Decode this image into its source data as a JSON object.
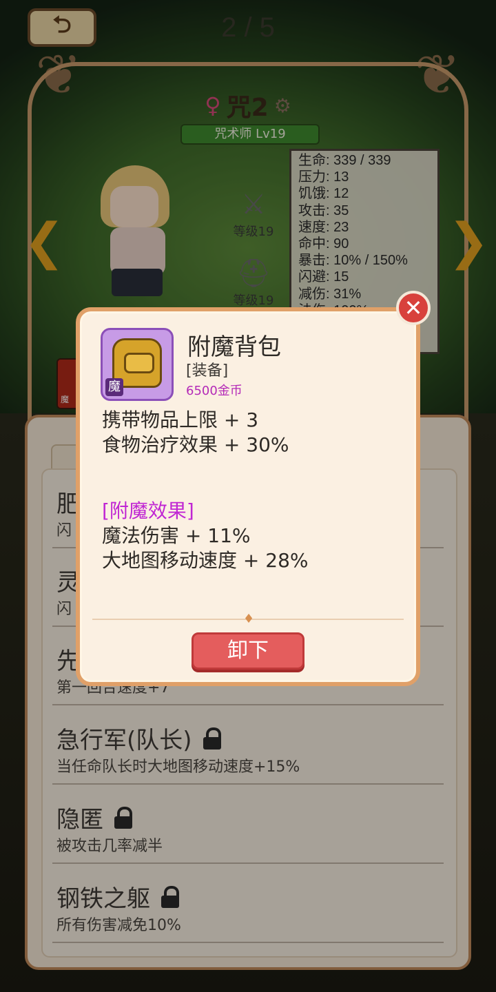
{
  "header": {
    "back_label": "⮌",
    "page_counter": "2 / 5"
  },
  "character": {
    "name": "咒2",
    "gender_symbol": "♀",
    "class_level": "咒术师 Lv19"
  },
  "equipment_slots": [
    {
      "icon": "sword-icon",
      "glyph": "⚔",
      "level": "等级19"
    },
    {
      "icon": "helmet-icon",
      "glyph": "⛑",
      "level": "等级19"
    }
  ],
  "stats": [
    "生命: 339 / 339",
    "压力: 13",
    "饥饿: 12",
    "攻击: 35",
    "速度: 23",
    "命中: 90",
    "暴击: 10% / 150%",
    "闪避: 15",
    "减伤: 31%",
    "法伤: 100%"
  ],
  "skill_badge": "魔",
  "traits": [
    {
      "name": "肥",
      "desc": "闪",
      "locked": false
    },
    {
      "name": "灵",
      "desc": "闪",
      "locked": false
    },
    {
      "name": "先",
      "desc": "第一回合速度+7",
      "locked": false
    },
    {
      "name": "急行军(队长)",
      "desc": "当任命队长时大地图移动速度+15%",
      "locked": true
    },
    {
      "name": "隐匿",
      "desc": "被攻击几率减半",
      "locked": true
    },
    {
      "name": "钢铁之躯",
      "desc": "所有伤害减免10%",
      "locked": true
    }
  ],
  "item_modal": {
    "name": "附魔背包",
    "type": "[装备]",
    "price": "6500金币",
    "tag": "魔",
    "effects": [
      "携带物品上限 + 3",
      "食物治疗效果 + 30%"
    ],
    "enchant_title": "[附魔效果]",
    "enchant_effects": [
      "魔法伤害 + 11%",
      "大地图移动速度 + 28%"
    ],
    "unequip_label": "卸下",
    "close_label": "✕"
  },
  "colors": {
    "accent_purple": "#c026d3",
    "button_red": "#e45d5d",
    "frame_tan": "#c79a6a"
  }
}
